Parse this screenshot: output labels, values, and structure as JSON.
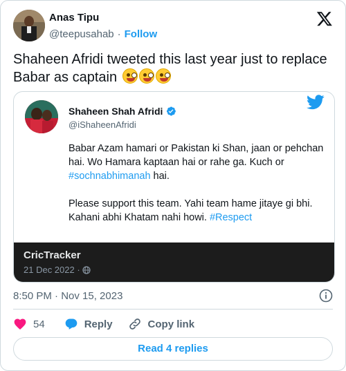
{
  "author": {
    "name": "Anas Tipu",
    "handle": "@teepusahab",
    "follow_label": "Follow"
  },
  "tweet": {
    "text": "Shaheen Afridi tweeted this last year just to replace Babar as captain",
    "emojis": [
      "zany-face-emoji",
      "zany-face-emoji",
      "zany-face-emoji"
    ]
  },
  "screenshot": {
    "name": "Shaheen Shah Afridi",
    "handle": "@iShaheenAfridi",
    "para1_before": "Babar Azam hamari or Pakistan ki Shan, jaan or pehchan hai. Wo Hamara kaptaan hai or rahe ga. Kuch or ",
    "para1_hashtag": "#sochnabhimanah",
    "para1_after": " hai.",
    "para2_before": "Please support this team. Yahi team hame jitaye gi bhi. Kahani abhi Khatam nahi howi. ",
    "para2_hashtag": "#Respect",
    "source_name": "CricTracker",
    "source_date": "21 Dec 2022 ·"
  },
  "meta": {
    "timestamp": "8:50 PM · Nov 15, 2023"
  },
  "actions": {
    "likes_count": "54",
    "reply_label": "Reply",
    "copy_link_label": "Copy link"
  },
  "read_replies_label": "Read 4 replies",
  "colors": {
    "accent": "#1d9bf0",
    "like": "#f91880",
    "text": "#0f1419",
    "muted": "#536471"
  }
}
